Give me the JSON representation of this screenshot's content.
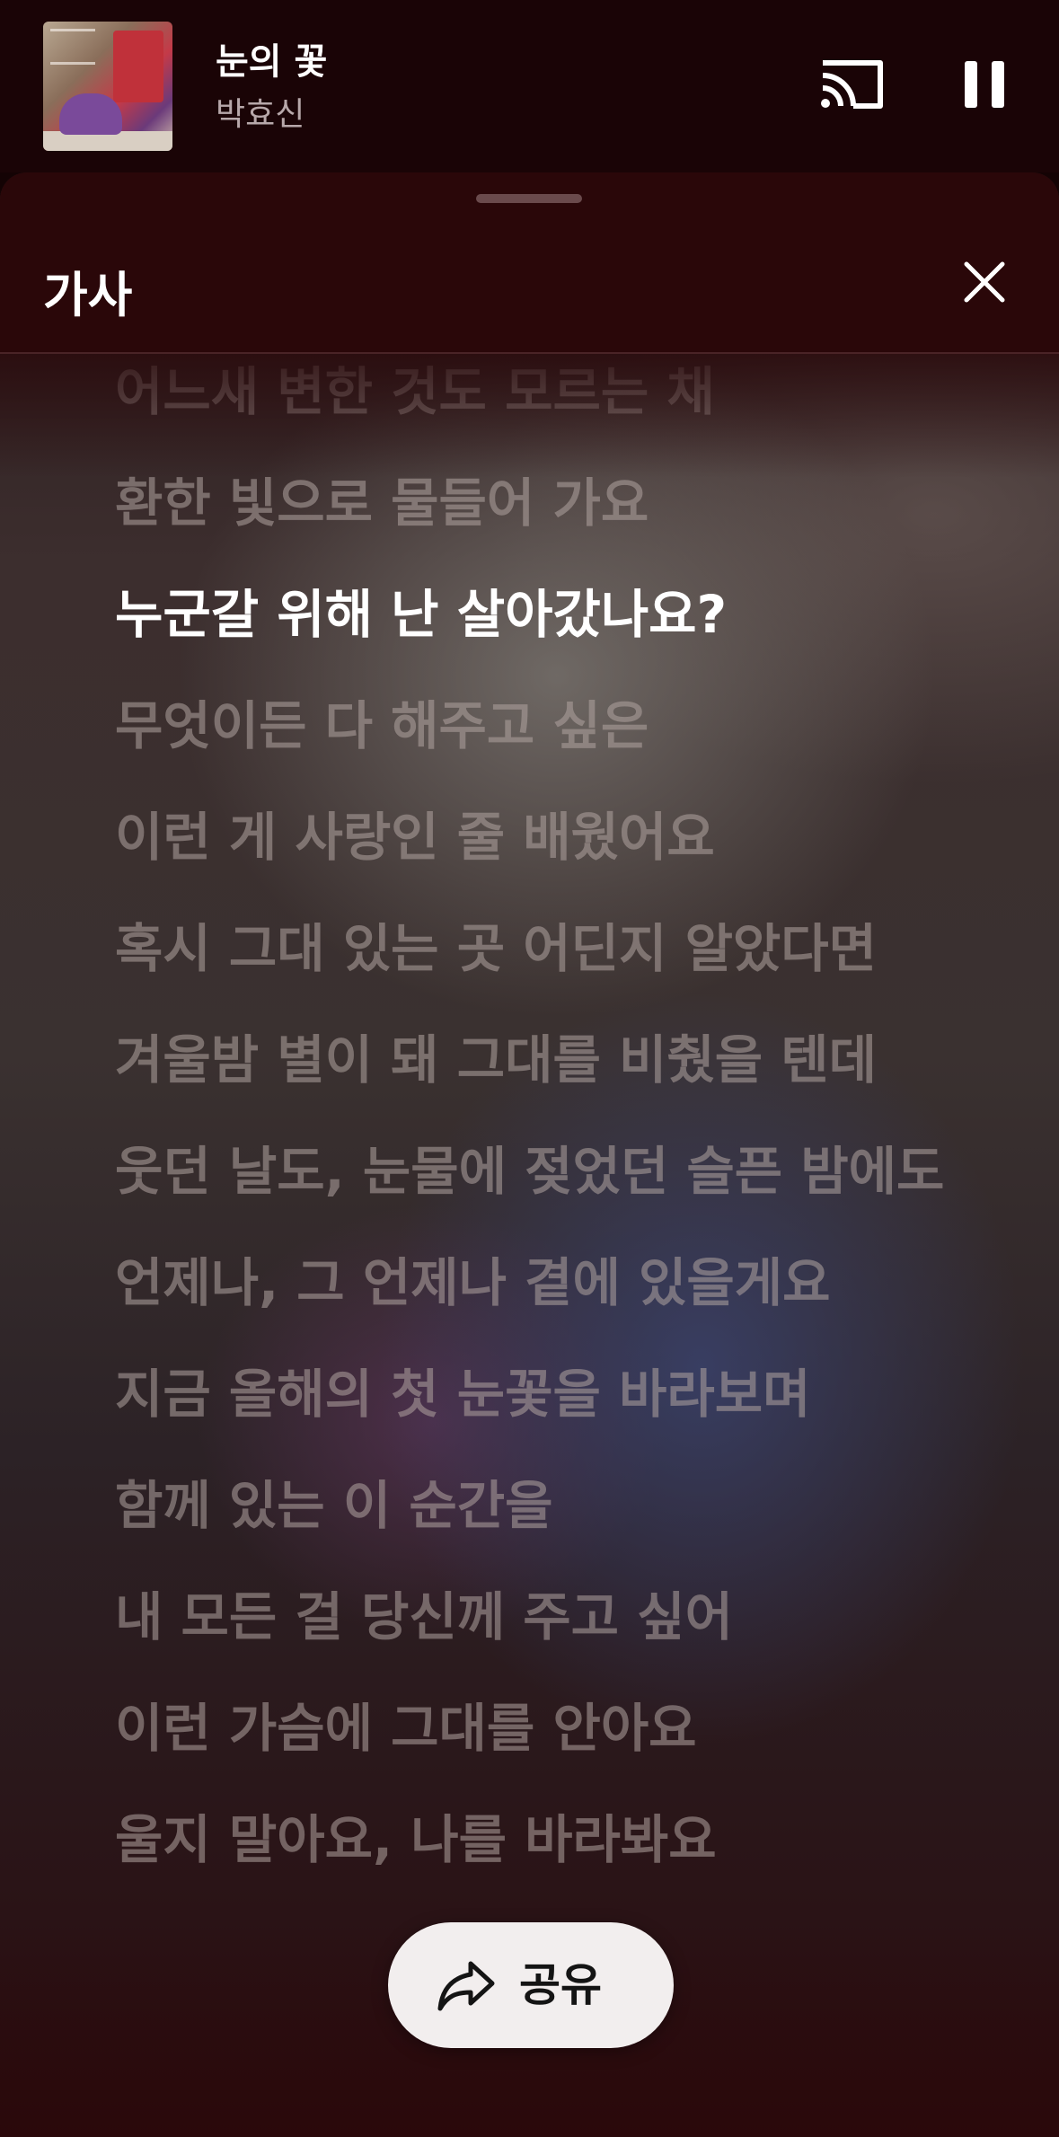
{
  "mini_player": {
    "song_title": "눈의 꽃",
    "artist": "박효신",
    "album_art_icon": "album-art-thumbnail",
    "cast_icon": "cast-icon",
    "pause_icon": "pause-icon"
  },
  "lyrics_sheet": {
    "title": "가사",
    "close_icon": "close-icon",
    "lines": [
      "어느새 변한 것도 모르는 채",
      "환한 빛으로 물들어 가요",
      "누군갈 위해 난 살아갔나요?",
      "무엇이든 다 해주고 싶은",
      "이런 게 사랑인 줄 배웠어요",
      "혹시 그대 있는 곳 어딘지 알았다면",
      "겨울밤 별이 돼 그대를 비췄을 텐데",
      "웃던 날도, 눈물에 젖었던 슬픈 밤에도",
      "언제나, 그 언제나 곁에 있을게요",
      "지금 올해의 첫 눈꽃을 바라보며",
      "함께 있는 이 순간을",
      "내 모든 걸 당신께 주고 싶어",
      "이런 가슴에 그대를 안아요",
      "울지 말아요, 나를 바라봐요"
    ],
    "active_line_index": 2
  },
  "share": {
    "label": "공유",
    "icon": "share-icon"
  },
  "colors": {
    "header_bg": "#1a0406",
    "sheet_header_bg": "#2a0709",
    "active_lyric": "#ffffff",
    "inactive_lyric": "#b0a4a0"
  }
}
